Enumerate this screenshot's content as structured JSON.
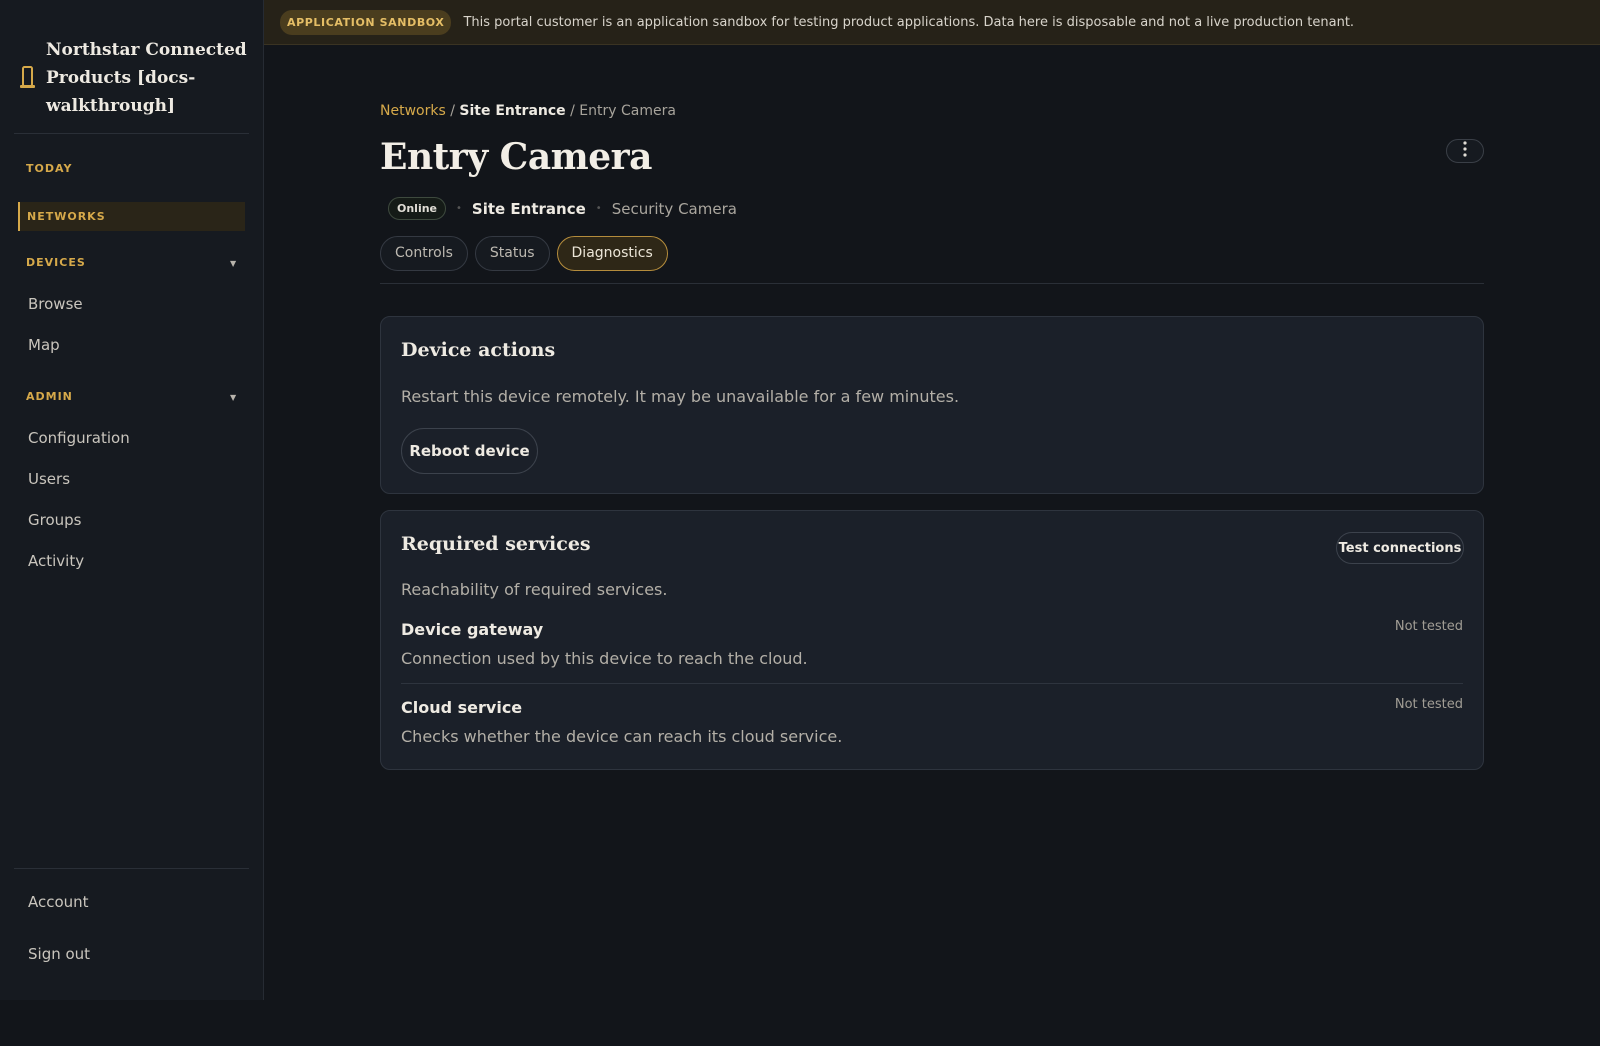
{
  "banner": {
    "badge": "APPLICATION SANDBOX",
    "text": "This portal customer is an application sandbox for testing product applications. Data here is disposable and not a live production tenant."
  },
  "sidebar": {
    "brand_icon": "building-icon",
    "brand_title": "Northstar Connected Products [docs-walkthrough]",
    "today": "TODAY",
    "networks": "NETWORKS",
    "devices": {
      "label": "DEVICES",
      "items": [
        "Browse",
        "Map"
      ]
    },
    "admin": {
      "label": "ADMIN",
      "items": [
        "Configuration",
        "Users",
        "Groups",
        "Activity"
      ]
    },
    "footer": [
      "Account",
      "Sign out"
    ]
  },
  "breadcrumb": {
    "networks": "Networks",
    "site": "Site Entrance",
    "current": "Entry Camera",
    "separator": "/"
  },
  "page": {
    "title": "Entry Camera",
    "status": "Online",
    "site": "Site Entrance",
    "type": "Security Camera"
  },
  "tabs": [
    {
      "label": "Controls",
      "active": false
    },
    {
      "label": "Status",
      "active": false
    },
    {
      "label": "Diagnostics",
      "active": true
    }
  ],
  "device_actions": {
    "title": "Device actions",
    "description": "Restart this device remotely. It may be unavailable for a few minutes.",
    "button": "Reboot device"
  },
  "required_services": {
    "title": "Required services",
    "button": "Test connections",
    "description": "Reachability of required services.",
    "services": [
      {
        "name": "Device gateway",
        "description": "Connection used by this device to reach the cloud.",
        "status": "Not tested"
      },
      {
        "name": "Cloud service",
        "description": "Checks whether the device can reach its cloud service.",
        "status": "Not tested"
      }
    ]
  },
  "colors": {
    "accent": "#d6a94a",
    "background": "#12151a",
    "card": "#1b2029"
  }
}
